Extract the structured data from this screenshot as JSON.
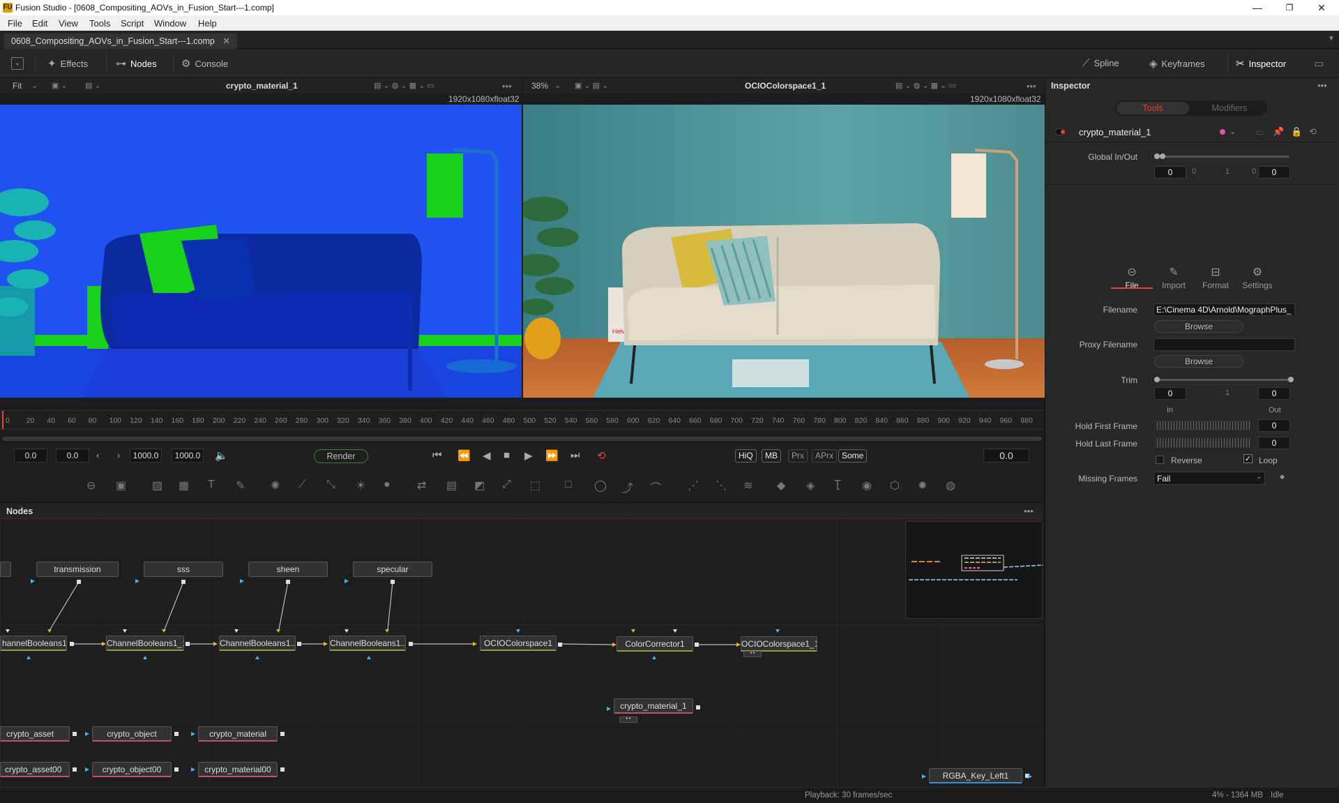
{
  "window": {
    "title": "Fusion Studio - [0608_Compositing_AOVs_in_Fusion_Start---1.comp]",
    "logo": "FU",
    "minimize": "—",
    "maximize": "❐",
    "close": "✕"
  },
  "menu": [
    "File",
    "Edit",
    "View",
    "Tools",
    "Script",
    "Window",
    "Help"
  ],
  "comp_tab": {
    "label": "0608_Compositing_AOVs_in_Fusion_Start---1.comp",
    "close": "✕"
  },
  "toolbar": {
    "effects": "Effects",
    "nodes": "Nodes",
    "console": "Console",
    "spline": "Spline",
    "keyframes": "Keyframes",
    "inspector": "Inspector"
  },
  "viewer_left": {
    "fit": "Fit",
    "name": "crypto_material_1",
    "resolution": "1920x1080xfloat32"
  },
  "viewer_right": {
    "zoom": "38%",
    "name": "OCIOColorspace1_1",
    "resolution": "1920x1080xfloat32",
    "poster_red_text": "Helvet"
  },
  "ruler": [
    "0",
    "20",
    "40",
    "60",
    "80",
    "100",
    "120",
    "140",
    "160",
    "180",
    "200",
    "220",
    "240",
    "260",
    "280",
    "300",
    "320",
    "340",
    "360",
    "380",
    "400",
    "420",
    "440",
    "460",
    "480",
    "500",
    "520",
    "540",
    "560",
    "580",
    "600",
    "620",
    "640",
    "660",
    "680",
    "700",
    "720",
    "740",
    "760",
    "780",
    "800",
    "820",
    "840",
    "860",
    "880",
    "900",
    "920",
    "940",
    "960",
    "980"
  ],
  "transport": {
    "start": "0.0",
    "current_in": "0.0",
    "end": "1000.0",
    "end2": "1000.0",
    "render": "Render",
    "hiq": "HiQ",
    "mb": "MB",
    "prx": "Prx",
    "aprx": "APrx",
    "some": "Some",
    "time": "0.0"
  },
  "nodes_panel": {
    "title": "Nodes"
  },
  "nodes": {
    "transmission": "transmission",
    "sss": "sss",
    "sheen": "sheen",
    "specular": "specular",
    "cb0": "hannelBooleans1",
    "cb1": "ChannelBooleans1_1",
    "cb2": "ChannelBooleans1...",
    "cb3": "ChannelBooleans1...",
    "ocio1": "OCIOColorspace1",
    "cc1": "ColorCorrector1",
    "ocio11": "OCIOColorspace1_1",
    "cm1": "crypto_material_1",
    "ca": "crypto_asset",
    "co": "crypto_object",
    "cm": "crypto_material",
    "ca00": "crypto_asset00",
    "co00": "crypto_object00",
    "cm00": "crypto_material00",
    "rgba": "RGBA_Key_Left1"
  },
  "inspector": {
    "title": "Inspector",
    "tab_tools": "Tools",
    "tab_modifiers": "Modifiers",
    "tool_name": "crypto_material_1",
    "global_label": "Global In/Out",
    "global_in": "0",
    "global_mid1": "0",
    "global_mid2": "1",
    "global_mid3": "0",
    "global_out": "0",
    "subtabs": [
      "File",
      "Import",
      "Format",
      "Settings"
    ],
    "filename_label": "Filename",
    "filename": "E:\\Cinema 4D\\Arnold\\MographPlus_",
    "browse": "Browse",
    "proxy_label": "Proxy Filename",
    "browse2": "Browse",
    "trim_label": "Trim",
    "trim_in": "0",
    "trim_mid": "1",
    "trim_out": "0",
    "in_label": "In",
    "out_label": "Out",
    "hold_first_label": "Hold First Frame",
    "hold_first": "0",
    "hold_last_label": "Hold Last Frame",
    "hold_last": "0",
    "reverse": "Reverse",
    "loop": "Loop",
    "missing_label": "Missing Frames",
    "missing": "Fail"
  },
  "status": {
    "playback": "Playback: 30 frames/sec",
    "memory": "4% - 1364 MB",
    "state": "Idle"
  }
}
